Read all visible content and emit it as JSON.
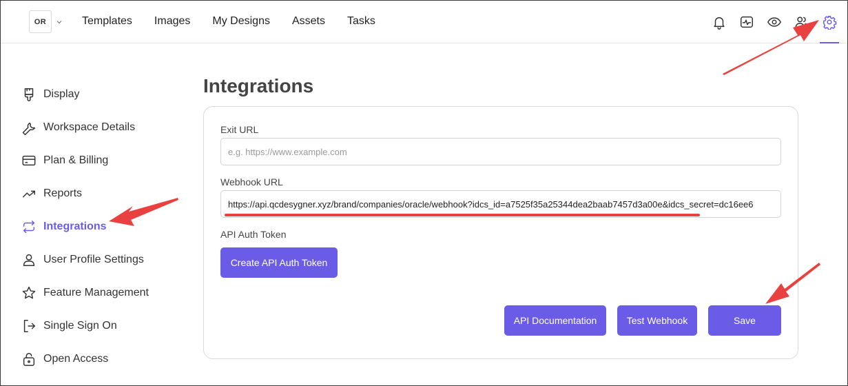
{
  "header": {
    "org_initials": "OR",
    "nav": [
      {
        "label": "Templates"
      },
      {
        "label": "Images"
      },
      {
        "label": "My Designs"
      },
      {
        "label": "Assets"
      },
      {
        "label": "Tasks"
      }
    ]
  },
  "sidebar": {
    "items": [
      {
        "label": "Display",
        "icon": "brush-icon"
      },
      {
        "label": "Workspace Details",
        "icon": "wrench-icon"
      },
      {
        "label": "Plan & Billing",
        "icon": "card-icon"
      },
      {
        "label": "Reports",
        "icon": "trend-icon"
      },
      {
        "label": "Integrations",
        "icon": "sync-icon",
        "active": true
      },
      {
        "label": "User Profile Settings",
        "icon": "user-icon"
      },
      {
        "label": "Feature Management",
        "icon": "star-icon"
      },
      {
        "label": "Single Sign On",
        "icon": "sign-in-icon"
      },
      {
        "label": "Open Access",
        "icon": "lock-open-icon"
      }
    ]
  },
  "main": {
    "title": "Integrations",
    "exit_url": {
      "label": "Exit URL",
      "placeholder": "e.g. https://www.example.com",
      "value": ""
    },
    "webhook_url": {
      "label": "Webhook URL",
      "value": "https://api.qcdesygner.xyz/brand/companies/oracle/webhook?idcs_id=a7525f35a25344dea2baab7457d3a00e&idcs_secret=dc16ee6"
    },
    "api_token": {
      "label": "API Auth Token",
      "button": "Create API Auth Token"
    },
    "buttons": {
      "api_docs": "API Documentation",
      "test_webhook": "Test Webhook",
      "save": "Save"
    }
  },
  "colors": {
    "accent": "#6b5ce7",
    "annotation": "#e8413f"
  }
}
